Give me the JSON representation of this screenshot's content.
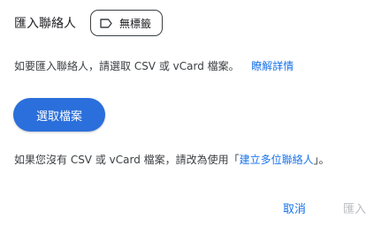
{
  "dialog": {
    "title": "匯入聯絡人",
    "label_chip": {
      "label": "無標籤",
      "icon": "label-outline-icon"
    },
    "info": {
      "text": "如要匯入聯絡人，請選取 CSV 或 vCard 檔案。",
      "link": "瞭解詳情"
    },
    "select_button": "選取檔案",
    "alternative": {
      "prefix": "如果您沒有 CSV 或 vCard 檔案，請改為使用「",
      "link": "建立多位聯絡人",
      "suffix": "」。"
    },
    "footer": {
      "cancel": "取消",
      "import": "匯入"
    }
  },
  "colors": {
    "accent": "#1a73e8",
    "primary_button": "#2a6fdb",
    "disabled_text": "#b9bcc0"
  }
}
